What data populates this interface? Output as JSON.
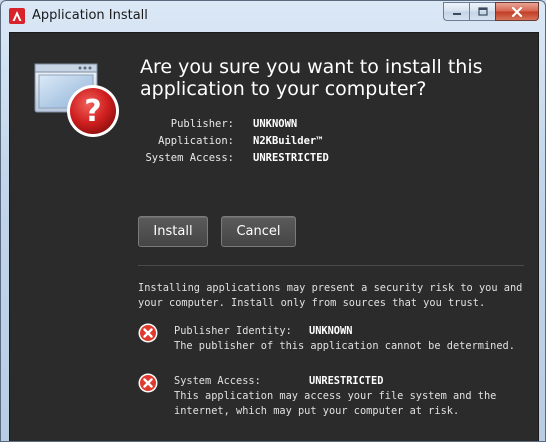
{
  "window": {
    "title": "Application Install",
    "controls": {
      "minimize": "minimize-icon",
      "maximize": "maximize-icon",
      "close": "close-icon"
    }
  },
  "dialog": {
    "question_line1": "Are you sure you want to install this",
    "question_line2": "application to your computer?",
    "details": [
      {
        "label": "Publisher:",
        "value": "UNKNOWN"
      },
      {
        "label": "Application:",
        "value": "N2KBuilder™"
      },
      {
        "label": "System Access:",
        "value": "UNRESTRICTED"
      }
    ],
    "buttons": {
      "install": "Install",
      "cancel": "Cancel"
    },
    "warning_line1": "Installing applications may present a security risk to you and",
    "warning_line2": "your computer. Install only from sources that you trust.",
    "risks": [
      {
        "label": "Publisher Identity:",
        "value": "UNKNOWN",
        "description": [
          "The publisher of this application cannot be determined."
        ]
      },
      {
        "label": "System Access:",
        "value": "UNRESTRICTED",
        "description": [
          "This application may access your file system and the",
          "internet, which may put your computer at risk."
        ]
      }
    ]
  },
  "colors": {
    "dialog_background": "#2b2b2b",
    "risk_icon": "#e0392d",
    "text": "#ffffff"
  },
  "icons": {
    "app": "adobe-air-icon",
    "hero": "window-question-icon",
    "risk": "error-x-icon"
  }
}
